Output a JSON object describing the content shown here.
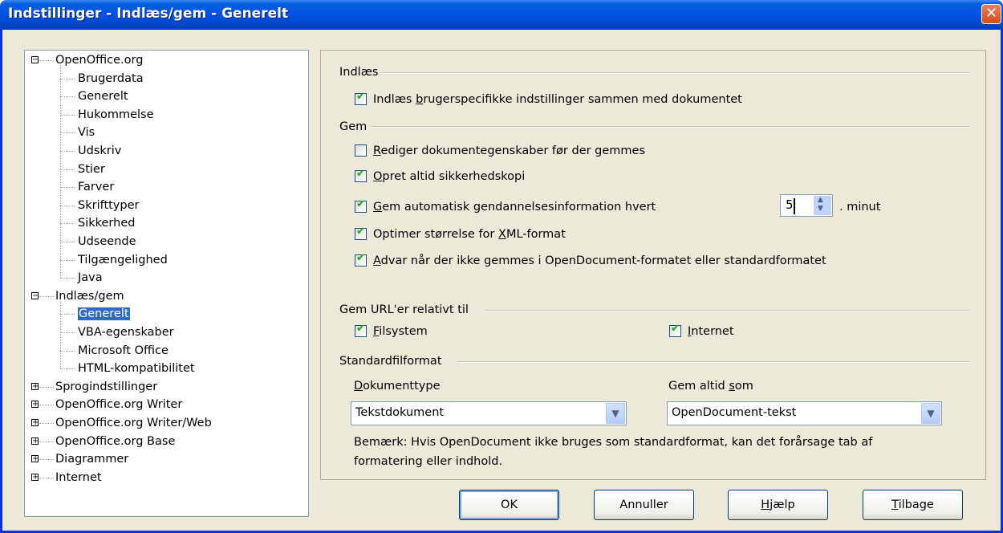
{
  "window": {
    "title": "Indstillinger - Indlæs/gem - Generelt",
    "close_icon": "close-icon"
  },
  "tree": {
    "groups": [
      {
        "label": "OpenOffice.org",
        "expanded": true,
        "children": [
          "Brugerdata",
          "Generelt",
          "Hukommelse",
          "Vis",
          "Udskriv",
          "Stier",
          "Farver",
          "Skrifttyper",
          "Sikkerhed",
          "Udseende",
          "Tilgængelighed",
          "Java"
        ]
      },
      {
        "label": "Indlæs/gem",
        "expanded": true,
        "children": [
          "Generelt",
          "VBA-egenskaber",
          "Microsoft Office",
          "HTML-kompatibilitet"
        ],
        "selected_child": 0
      },
      {
        "label": "Sprogindstillinger",
        "expanded": false
      },
      {
        "label": "OpenOffice.org Writer",
        "expanded": false
      },
      {
        "label": "OpenOffice.org Writer/Web",
        "expanded": false
      },
      {
        "label": "OpenOffice.org Base",
        "expanded": false
      },
      {
        "label": "Diagrammer",
        "expanded": false
      },
      {
        "label": "Internet",
        "expanded": false
      }
    ]
  },
  "load": {
    "section": "Indlæs",
    "user_settings": {
      "pre": "Indlæs ",
      "u": "b",
      "post": "rugerspecifikke indstillinger sammen med dokumentet",
      "checked": true
    }
  },
  "save": {
    "section": "Gem",
    "edit_props": {
      "u": "R",
      "post": "ediger dokumentegenskaber før der gemmes",
      "checked": false
    },
    "backup": {
      "u": "O",
      "post": "pret altid sikkerhedskopi",
      "checked": true
    },
    "autorecover": {
      "u": "G",
      "post": "em automatisk gendannelsesinformation hvert",
      "checked": true,
      "value": "5",
      "unit": ". minut"
    },
    "optimize": {
      "pre": "Optimer størrelse for ",
      "u": "X",
      "post": "ML-format",
      "checked": true
    },
    "warn": {
      "u": "A",
      "post": "dvar når der ikke gemmes i OpenDocument-formatet eller standardformatet",
      "checked": true
    }
  },
  "url": {
    "section": "Gem URL'er relativt til",
    "filesystem": {
      "u": "F",
      "post": "ilsystem",
      "checked": true
    },
    "internet": {
      "u": "I",
      "post": "nternet",
      "checked": true
    }
  },
  "default_format": {
    "section": "Standardfilformat",
    "doctype_label": {
      "u": "D",
      "post": "okumenttype"
    },
    "doctype_value": "Tekstdokument",
    "saveas_label": {
      "pre": "Gem altid ",
      "u": "s",
      "post": "om"
    },
    "saveas_value": "OpenDocument-tekst",
    "note_line1": "Bemærk: Hvis OpenDocument ikke bruges som standardformat, kan det forårsage tab af",
    "note_line2": "formatering eller indhold."
  },
  "buttons": {
    "ok": "OK",
    "cancel": "Annuller",
    "help": {
      "u": "H",
      "post": "jælp"
    },
    "back": {
      "u": "T",
      "post": "ilbage"
    }
  }
}
